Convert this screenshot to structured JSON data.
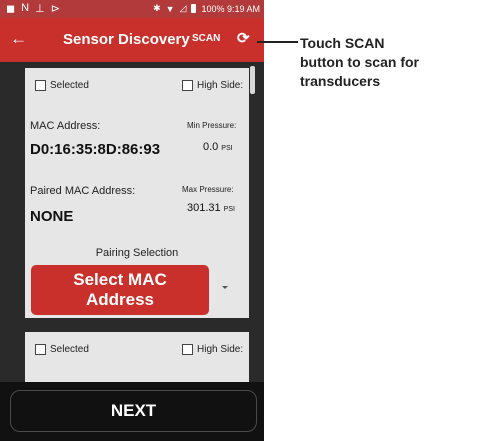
{
  "status_bar": {
    "left_icons": [
      "◼",
      "N",
      "⊥",
      "⊳"
    ],
    "right_text": "100% 9:19 AM",
    "icons": [
      "bluetooth-icon",
      "wifi-icon",
      "signal-icon",
      "battery-icon"
    ]
  },
  "app_bar": {
    "back_glyph": "←",
    "title": "Sensor Discovery",
    "scan_label": "SCAN",
    "refresh_glyph": "⟳",
    "color": "#c9302c"
  },
  "cards": [
    {
      "selected_label": "Selected",
      "high_side_label": "High Side:",
      "mac_label": "MAC Address:",
      "mac_value": "D0:16:35:8D:86:93",
      "min_pressure_label": "Min Pressure:",
      "min_pressure_value": "0.0",
      "min_pressure_unit": "PSI",
      "paired_label": "Paired MAC Address:",
      "paired_value": "NONE",
      "max_pressure_label": "Max Pressure:",
      "max_pressure_value": "301.31",
      "max_pressure_unit": "PSI",
      "pairing_label": "Pairing Selection",
      "select_line1": "Select MAC",
      "select_line2": "Address"
    },
    {
      "selected_label": "Selected",
      "high_side_label": "High Side:"
    }
  ],
  "next_label": "NEXT",
  "callout": {
    "line1": "Touch SCAN",
    "line2": "button to scan for",
    "line3": "transducers"
  }
}
